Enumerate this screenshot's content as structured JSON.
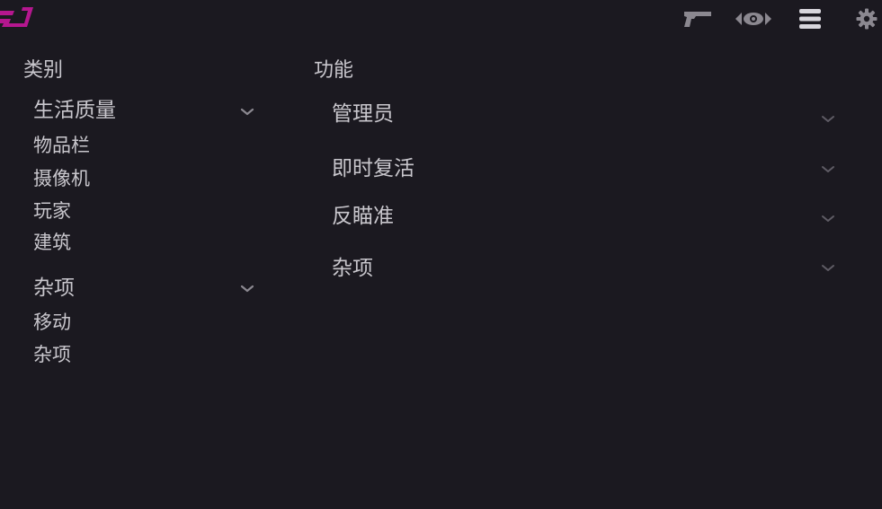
{
  "app": {
    "logo_icon": "logo-icon",
    "accent_color": "#b5178f"
  },
  "toolbar": {
    "icons": [
      "pistol-icon",
      "eye-icon",
      "menu-icon",
      "gear-icon"
    ]
  },
  "categories": {
    "heading": "类别",
    "groups": [
      {
        "label": "生活质量",
        "items": [
          "物品栏",
          "摄像机",
          "玩家",
          "建筑"
        ]
      },
      {
        "label": "杂项",
        "items": [
          "移动",
          "杂项"
        ]
      }
    ]
  },
  "features": {
    "heading": "功能",
    "items": [
      "管理员",
      "即时复活",
      "反瞄准",
      "杂项"
    ]
  }
}
